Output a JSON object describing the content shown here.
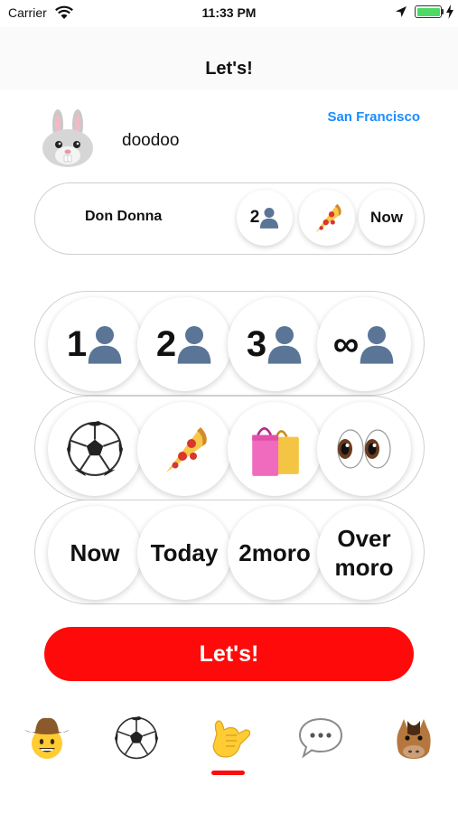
{
  "status_bar": {
    "carrier": "Carrier",
    "time": "11:33 PM"
  },
  "nav": {
    "title": "Let's!"
  },
  "profile": {
    "username": "doodoo",
    "location": "San Francisco",
    "avatar_icon": "bunny-face-icon"
  },
  "summary": {
    "name": "Don Donna",
    "people_count": "2",
    "activity_icon": "pizza-icon",
    "time": "Now"
  },
  "people_options": [
    {
      "number": "1",
      "icon": "person-silhouette-icon"
    },
    {
      "number": "2",
      "icon": "person-silhouette-icon"
    },
    {
      "number": "3",
      "icon": "person-silhouette-icon"
    },
    {
      "number": "∞",
      "icon": "person-silhouette-icon"
    }
  ],
  "activity_options": [
    {
      "icon": "soccer-ball-icon"
    },
    {
      "icon": "pizza-icon"
    },
    {
      "icon": "shopping-bags-icon"
    },
    {
      "icon": "eyes-icon"
    }
  ],
  "time_options": [
    {
      "line1": "Now",
      "line2": ""
    },
    {
      "line1": "Today",
      "line2": ""
    },
    {
      "line1": "2moro",
      "line2": ""
    },
    {
      "line1": "Over",
      "line2": "moro"
    }
  ],
  "cta": {
    "label": "Let's!"
  },
  "tab_bar": {
    "tabs": [
      {
        "icon": "cowboy-face-icon"
      },
      {
        "icon": "soccer-ball-icon"
      },
      {
        "icon": "call-me-hand-icon",
        "selected": true
      },
      {
        "icon": "speech-bubble-icon"
      },
      {
        "icon": "horse-face-icon"
      }
    ]
  },
  "colors": {
    "accent": "#ff0a0a",
    "location": "#1a8cff",
    "person_icon": "#5a7596"
  }
}
